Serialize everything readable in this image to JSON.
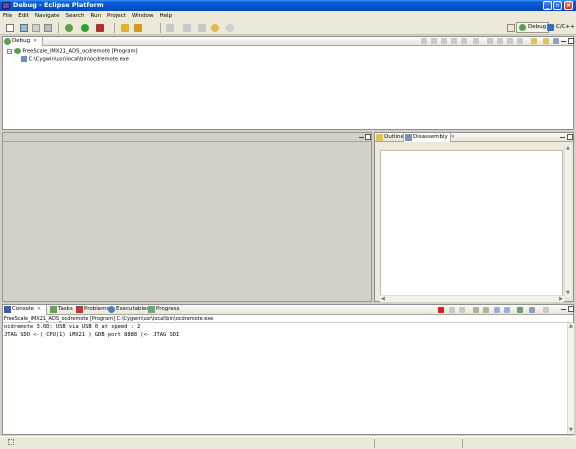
{
  "window": {
    "title": "Debug - Eclipse Platform"
  },
  "menu": [
    "File",
    "Edit",
    "Navigate",
    "Search",
    "Run",
    "Project",
    "Window",
    "Help"
  ],
  "perspectives": [
    {
      "label": "Debug",
      "active": true
    },
    {
      "label": "C/C++",
      "active": false
    }
  ],
  "debug_view": {
    "tab_label": "Debug",
    "tree": [
      {
        "label": "FreeScale_iMX21_ADS_ocdremote [Program]",
        "icon": "debug-launch-icon"
      },
      {
        "label": "C:\\Cygwin\\usr\\local\\bin\\ocdremote.exe",
        "icon": "process-icon"
      }
    ]
  },
  "outline_view": {
    "tabs": [
      {
        "label": "Outline",
        "active": false
      },
      {
        "label": "Disassembly",
        "active": true
      }
    ]
  },
  "console_view": {
    "tabs": [
      {
        "label": "Console",
        "active": true
      },
      {
        "label": "Tasks",
        "active": false
      },
      {
        "label": "Problems",
        "active": false
      },
      {
        "label": "Executables",
        "active": false
      },
      {
        "label": "Progress",
        "active": false
      }
    ],
    "header": "FreeScale_iMX21_ADS_ocdremote [Program] C:\\Cygwin\\usr\\local\\bin\\ocdremote.exe",
    "lines": [
      "ocdremote 3.0D: USB via USB 0 at speed : 2",
      "JTAG SDO <-( CPU(1) iMX21 ) GDB port 8888 (<- JTAG SDI"
    ]
  },
  "colors": {
    "titlebar": "#0553d1",
    "chrome": "#ece9d8",
    "terminate_red": "#d42020"
  }
}
